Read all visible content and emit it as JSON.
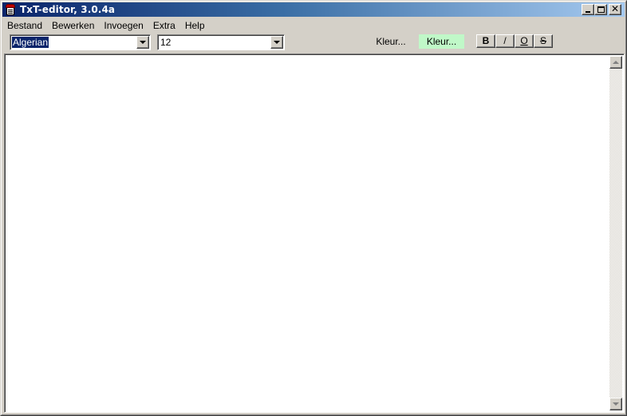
{
  "window": {
    "title": "TxT-editor, 3.0.4a",
    "close_glyph": "✕"
  },
  "menubar": {
    "items": [
      "Bestand",
      "Bewerken",
      "Invoegen",
      "Extra",
      "Help"
    ]
  },
  "toolbar": {
    "font_select": {
      "value": "Algerian"
    },
    "size_select": {
      "value": "12"
    },
    "text_color_button": {
      "label": "Kleur...",
      "color": "#d4d0c8"
    },
    "background_color_button": {
      "label": "Kleur...",
      "color": "#c0f8c8"
    },
    "format_buttons": {
      "bold": "B",
      "italic": "/",
      "underline": "O",
      "strike": "S"
    }
  },
  "editor": {
    "content": ""
  },
  "colors": {
    "titlebar_start": "#0a246a",
    "titlebar_end": "#a6caf0",
    "face": "#d4d0c8",
    "selection": "#0a246a"
  }
}
